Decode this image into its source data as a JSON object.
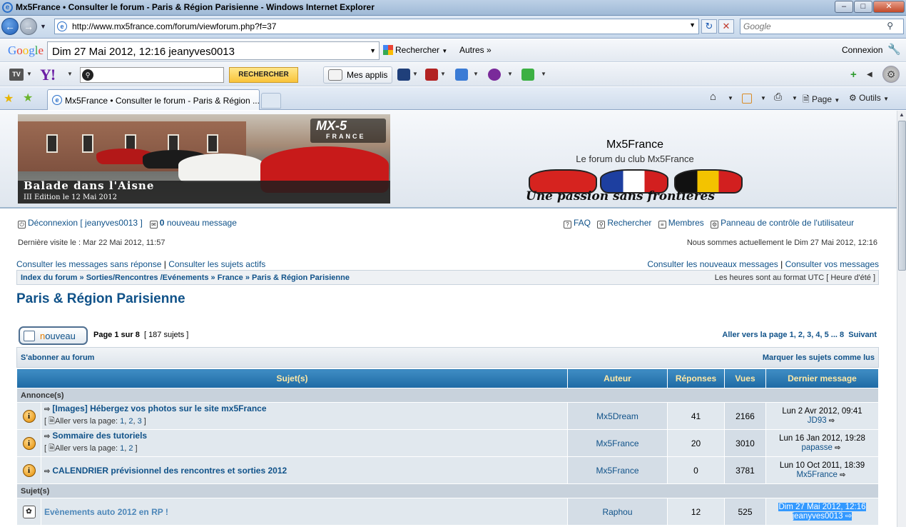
{
  "window": {
    "title": "Mx5France • Consulter le forum - Paris & Région Parisienne - Windows Internet Explorer"
  },
  "address": {
    "url": "http://www.mx5france.com/forum/viewforum.php?f=37",
    "search_placeholder": "Google"
  },
  "google_toolbar": {
    "logo": "Google",
    "query": "Dim 27 Mai 2012, 12:16 jeanyves0013",
    "search_label": "Rechercher",
    "more_label": "Autres",
    "signin_label": "Connexion"
  },
  "yahoo_toolbar": {
    "search_button": "RECHERCHER",
    "apps_label": "Mes applis"
  },
  "tabs": [
    {
      "label": "Mx5France • Consulter le forum - Paris & Région ..."
    }
  ],
  "command_bar": {
    "page_label": "Page",
    "tools_label": "Outils"
  },
  "banner": {
    "event_line1": "Balade dans l'Aisne",
    "event_line2": "III Edition le 12 Mai 2012",
    "mx_logo": "MX-5",
    "mx_logo_sub": "FRANCE",
    "site_title": "Mx5France",
    "site_desc": "Le forum du club Mx5France",
    "slogan": "Une passion sans frontières"
  },
  "userbar": {
    "logout": "Déconnexion [ jeanyves0013 ]",
    "new_messages_count": "0",
    "new_messages_label": "nouveau message",
    "faq": "FAQ",
    "search": "Rechercher",
    "members": "Membres",
    "ucp": "Panneau de contrôle de l'utilisateur",
    "last_visit": "Dernière visite le : Mar 22 Mai 2012, 11:57",
    "current_time": "Nous sommes actuellement le Dim 27 Mai 2012, 12:16"
  },
  "search_links": {
    "unanswered": "Consulter les messages sans réponse",
    "active": "Consulter les sujets actifs",
    "new_posts": "Consulter les nouveaux messages",
    "your_posts": "Consulter vos messages"
  },
  "breadcrumbs": {
    "items": [
      "Index du forum",
      "Sorties/Rencontres /Evénements",
      "France",
      "Paris & Région Parisienne"
    ],
    "timezone": "Les heures sont au format UTC [ Heure d'été ]"
  },
  "forum": {
    "title": "Paris & Région Parisienne",
    "new_topic_first": "n",
    "new_topic_rest": "ouveau",
    "page_info": "Page 1 sur 8",
    "topic_count": "[ 187 sujets ]",
    "goto_label": "Aller vers la page",
    "pages": [
      "1",
      "2",
      "3",
      "4",
      "5",
      "...",
      "8"
    ],
    "next_label": "Suivant",
    "subscribe": "S'abonner au forum",
    "mark_read": "Marquer les sujets comme lus"
  },
  "table": {
    "headers": {
      "subject": "Sujet(s)",
      "author": "Auteur",
      "replies": "Réponses",
      "views": "Vues",
      "last_post": "Dernier message"
    },
    "announcements_label": "Annonce(s)",
    "topics_label": "Sujet(s)",
    "rows": [
      {
        "title": "[Images] Hébergez vos photos sur le site mx5France",
        "pages_text": "Aller vers la page:",
        "pages": [
          "1",
          "2",
          "3"
        ],
        "author": "Mx5Dream",
        "replies": "41",
        "views": "2166",
        "last_date": "Lun 2 Avr 2012, 09:41",
        "last_user": "JD93"
      },
      {
        "title": "Sommaire des tutoriels",
        "pages_text": "Aller vers la page:",
        "pages": [
          "1",
          "2"
        ],
        "author": "Mx5France",
        "replies": "20",
        "views": "3010",
        "last_date": "Lun 16 Jan 2012, 19:28",
        "last_user": "papasse"
      },
      {
        "title": "CALENDRIER prévisionnel des rencontres et sorties 2012",
        "author": "Mx5France",
        "replies": "0",
        "views": "3781",
        "last_date": "Lun 10 Oct 2011, 18:39",
        "last_user": "Mx5France"
      },
      {
        "title": "Evènements auto 2012 en RP !",
        "author": "Raphou",
        "replies": "12",
        "views": "525",
        "last_date": "Dim 27 Mai 2012, 12:16",
        "last_user": "jeanyves0013"
      }
    ]
  }
}
